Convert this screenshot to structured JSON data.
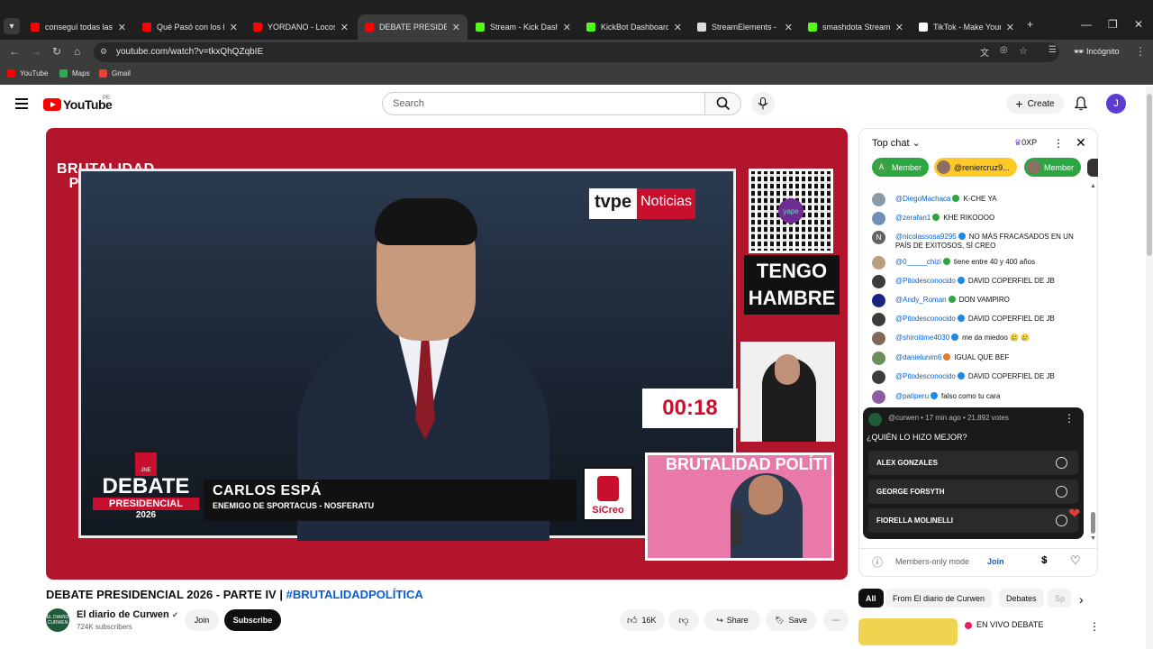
{
  "browser": {
    "tabs": [
      {
        "title": "conseguí todas las m",
        "favicon": "youtube",
        "color": "#ff0000"
      },
      {
        "title": "Qué Pasó con los PR",
        "favicon": "youtube",
        "color": "#ff0000"
      },
      {
        "title": "YORDANO - Locos de",
        "favicon": "youtube",
        "color": "#ff0000"
      },
      {
        "title": "DEBATE PRESIDEN",
        "favicon": "youtube",
        "color": "#ff0000",
        "active": true
      },
      {
        "title": "Stream - Kick Dashbo",
        "favicon": "kick",
        "color": "#53fc18"
      },
      {
        "title": "KickBot Dashboard",
        "favicon": "kick",
        "color": "#53fc18"
      },
      {
        "title": "StreamElements - em",
        "favicon": "streamelements",
        "color": "#dddddd"
      },
      {
        "title": "smashdota Stream - ",
        "favicon": "kick",
        "color": "#53fc18"
      },
      {
        "title": "TikTok - Make Your D",
        "favicon": "tiktok",
        "color": "#ffffff"
      }
    ],
    "url": "youtube.com/watch?v=tkxQhQZqbIE",
    "mode": "Incógnito",
    "bookmarks": [
      {
        "label": "YouTube",
        "color": "#ff0000"
      },
      {
        "label": "Maps",
        "color": "#34a853"
      },
      {
        "label": "Gmail",
        "color": "#ea4335"
      }
    ]
  },
  "header": {
    "logo_text": "YouTube",
    "country_code": "PE",
    "search_placeholder": "Search",
    "create_label": "Create",
    "avatar_letter": "J"
  },
  "video": {
    "brand_logo": "BRUTALIDAD POLÍTICA",
    "network_a": "tvpe",
    "network_b": "Noticias",
    "qr_brand": "yape",
    "hambre_line1": "TENGO",
    "hambre_line2": "HAMBRE",
    "timer": "00:18",
    "cam_overlay": "BRUTALIDAD POLÍTI",
    "debate_org": "JNE",
    "debate_word": "DEBATE",
    "debate_sub": "PRESIDENCIAL",
    "debate_year": "2026",
    "lower_third_name": "CARLOS ESPÁ",
    "lower_third_role": "ENEMIGO DE SPORTACUS - NOSFERATU",
    "sicreo_label": "SíCreo"
  },
  "below_video": {
    "title": "DEBATE PRESIDENCIAL 2026 - PARTE IV | ",
    "title_tag": "#BRUTALIDADPOLÍTICA",
    "channel_name": "El diario de Curwen",
    "channel_subs": "724K subscribers",
    "join_label": "Join",
    "subscribe_label": "Subscribe",
    "like_count": "16K",
    "share_label": "Share",
    "save_label": "Save"
  },
  "chat": {
    "mode_label": "Top chat",
    "xp_label": "0XP",
    "chips": [
      {
        "label": "Member",
        "bg": "#2ba640",
        "avatar": "A"
      },
      {
        "label": "@reniercruz9...",
        "bg": "#ffca28",
        "avatar": ""
      },
      {
        "label": "Member",
        "bg": "#2ba640",
        "avatar": ""
      }
    ],
    "messages": [
      {
        "author": "@DiegoMachaca",
        "text": "K-CHE YA",
        "badge_color": "#2ba640",
        "avatar_color": "#8a9aa6"
      },
      {
        "author": "@zerafan1",
        "text": "KHE RIKOOOO",
        "badge_color": "#2ba640",
        "avatar_color": "#6f8fb8"
      },
      {
        "author": "@nicolassosa9295",
        "text": "NO MÁS FRACASADOS EN UN PAÍS DE EXITOSOS, SÍ CREO",
        "badge_color": "#1e88e5",
        "avatar_color": "#5f6368",
        "avatar_letter": "N"
      },
      {
        "author": "@0_____chizi",
        "text": "tiene entre 40 y 400 años",
        "badge_color": "#2ba640",
        "avatar_color": "#b8a07e"
      },
      {
        "author": "@Pitodesconocido",
        "text": "DAVID COPERFIEL DE JB",
        "badge_color": "#1e88e5",
        "avatar_color": "#3b3b3b"
      },
      {
        "author": "@Andy_Roman",
        "text": "DON VAMPIRO",
        "badge_color": "#2ba640",
        "avatar_color": "#1a237e"
      },
      {
        "author": "@Pitodesconocido",
        "text": "DAVID COPERFIEL DE JB",
        "badge_color": "#1e88e5",
        "avatar_color": "#3b3b3b"
      },
      {
        "author": "@shiroitime4030",
        "text": "me da miedoo 🥲 🥲",
        "badge_color": "#1e88e5",
        "avatar_color": "#7e6a5a"
      },
      {
        "author": "@danielunim6",
        "text": "IGUAL QUE BEF",
        "badge_color": "#e07b2a",
        "avatar_color": "#6b8e5a"
      },
      {
        "author": "@Pitodesconocido",
        "text": "DAVID COPERFIEL DE JB",
        "badge_color": "#1e88e5",
        "avatar_color": "#3b3b3b"
      },
      {
        "author": "@patiperu",
        "text": "falso como tu cara",
        "badge_color": "#1e88e5",
        "avatar_color": "#8e5aa0"
      }
    ],
    "poll": {
      "meta": "@curwen • 17 min ago • 21,892 votes",
      "question": "¿QUIÉN LO HIZO MEJOR?",
      "options": [
        "ALEX GONZALES",
        "GEORGE FORSYTH",
        "FIORELLA MOLINELLI"
      ]
    },
    "members_mode": "Members-only mode",
    "join_label": "Join"
  },
  "recommendations": {
    "chips": [
      "All",
      "From El diario de Curwen",
      "Debates",
      "Sp"
    ],
    "first_title": "EN VIVO DEBATE"
  }
}
